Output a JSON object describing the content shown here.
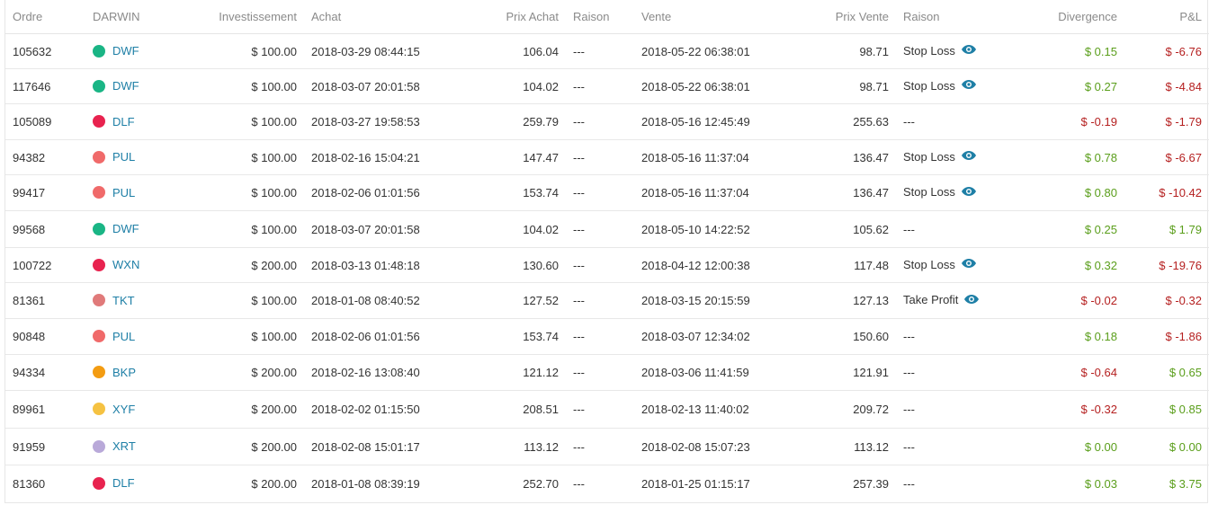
{
  "colors": {
    "link": "#1e7fa6",
    "positive": "#5a9e1b",
    "negative": "#b52020",
    "eye_icon": "#1e7fa6"
  },
  "headers": {
    "ordre": "Ordre",
    "darwin": "DARWIN",
    "investissement": "Investissement",
    "achat": "Achat",
    "prix_achat": "Prix Achat",
    "raison_achat": "Raison",
    "vente": "Vente",
    "prix_vente": "Prix Vente",
    "raison_vente": "Raison",
    "divergence": "Divergence",
    "pl": "P&L"
  },
  "rows": [
    {
      "ordre": "105632",
      "darwin": "DWF",
      "color": "#1ab585",
      "investissement": "$ 100.00",
      "achat": "2018-03-29 08:44:15",
      "prix_achat": "106.04",
      "raison_achat": "---",
      "vente": "2018-05-22 06:38:01",
      "prix_vente": "98.71",
      "raison_vente": "Stop Loss",
      "eye": true,
      "divergence": "$ 0.15",
      "divergence_sign": "pos",
      "pl": "$ -6.76",
      "pl_sign": "neg"
    },
    {
      "ordre": "117646",
      "darwin": "DWF",
      "color": "#1ab585",
      "investissement": "$ 100.00",
      "achat": "2018-03-07 20:01:58",
      "prix_achat": "104.02",
      "raison_achat": "---",
      "vente": "2018-05-22 06:38:01",
      "prix_vente": "98.71",
      "raison_vente": "Stop Loss",
      "eye": true,
      "divergence": "$ 0.27",
      "divergence_sign": "pos",
      "pl": "$ -4.84",
      "pl_sign": "neg"
    },
    {
      "ordre": "105089",
      "darwin": "DLF",
      "color": "#e8234f",
      "investissement": "$ 100.00",
      "achat": "2018-03-27 19:58:53",
      "prix_achat": "259.79",
      "raison_achat": "---",
      "vente": "2018-05-16 12:45:49",
      "prix_vente": "255.63",
      "raison_vente": "---",
      "eye": false,
      "divergence": "$ -0.19",
      "divergence_sign": "neg",
      "pl": "$ -1.79",
      "pl_sign": "neg"
    },
    {
      "ordre": "94382",
      "darwin": "PUL",
      "color": "#f06a6a",
      "investissement": "$ 100.00",
      "achat": "2018-02-16 15:04:21",
      "prix_achat": "147.47",
      "raison_achat": "---",
      "vente": "2018-05-16 11:37:04",
      "prix_vente": "136.47",
      "raison_vente": "Stop Loss",
      "eye": true,
      "divergence": "$ 0.78",
      "divergence_sign": "pos",
      "pl": "$ -6.67",
      "pl_sign": "neg"
    },
    {
      "ordre": "99417",
      "darwin": "PUL",
      "color": "#f06a6a",
      "investissement": "$ 100.00",
      "achat": "2018-02-06 01:01:56",
      "prix_achat": "153.74",
      "raison_achat": "---",
      "vente": "2018-05-16 11:37:04",
      "prix_vente": "136.47",
      "raison_vente": "Stop Loss",
      "eye": true,
      "divergence": "$ 0.80",
      "divergence_sign": "pos",
      "pl": "$ -10.42",
      "pl_sign": "neg"
    },
    {
      "ordre": "99568",
      "darwin": "DWF",
      "color": "#1ab585",
      "investissement": "$ 100.00",
      "achat": "2018-03-07 20:01:58",
      "prix_achat": "104.02",
      "raison_achat": "---",
      "vente": "2018-05-10 14:22:52",
      "prix_vente": "105.62",
      "raison_vente": "---",
      "eye": false,
      "divergence": "$ 0.25",
      "divergence_sign": "pos",
      "pl": "$ 1.79",
      "pl_sign": "pos"
    },
    {
      "ordre": "100722",
      "darwin": "WXN",
      "color": "#e8234f",
      "investissement": "$ 200.00",
      "achat": "2018-03-13 01:48:18",
      "prix_achat": "130.60",
      "raison_achat": "---",
      "vente": "2018-04-12 12:00:38",
      "prix_vente": "117.48",
      "raison_vente": "Stop Loss",
      "eye": true,
      "divergence": "$ 0.32",
      "divergence_sign": "pos",
      "pl": "$ -19.76",
      "pl_sign": "neg"
    },
    {
      "ordre": "81361",
      "darwin": "TKT",
      "color": "#e07a7a",
      "investissement": "$ 100.00",
      "achat": "2018-01-08 08:40:52",
      "prix_achat": "127.52",
      "raison_achat": "---",
      "vente": "2018-03-15 20:15:59",
      "prix_vente": "127.13",
      "raison_vente": "Take Profit",
      "eye": true,
      "divergence": "$ -0.02",
      "divergence_sign": "neg",
      "pl": "$ -0.32",
      "pl_sign": "neg"
    },
    {
      "ordre": "90848",
      "darwin": "PUL",
      "color": "#f06a6a",
      "investissement": "$ 100.00",
      "achat": "2018-02-06 01:01:56",
      "prix_achat": "153.74",
      "raison_achat": "---",
      "vente": "2018-03-07 12:34:02",
      "prix_vente": "150.60",
      "raison_vente": "---",
      "eye": false,
      "divergence": "$ 0.18",
      "divergence_sign": "pos",
      "pl": "$ -1.86",
      "pl_sign": "neg"
    },
    {
      "ordre": "94334",
      "darwin": "BKP",
      "color": "#f39c12",
      "investissement": "$ 200.00",
      "achat": "2018-02-16 13:08:40",
      "prix_achat": "121.12",
      "raison_achat": "---",
      "vente": "2018-03-06 11:41:59",
      "prix_vente": "121.91",
      "raison_vente": "---",
      "eye": false,
      "divergence": "$ -0.64",
      "divergence_sign": "neg",
      "pl": "$ 0.65",
      "pl_sign": "pos"
    },
    {
      "ordre": "89961",
      "darwin": "XYF",
      "color": "#f5c242",
      "investissement": "$ 200.00",
      "achat": "2018-02-02 01:15:50",
      "prix_achat": "208.51",
      "raison_achat": "---",
      "vente": "2018-02-13 11:40:02",
      "prix_vente": "209.72",
      "raison_vente": "---",
      "eye": false,
      "divergence": "$ -0.32",
      "divergence_sign": "neg",
      "pl": "$ 0.85",
      "pl_sign": "pos"
    },
    {
      "ordre": "91959",
      "darwin": "XRT",
      "color": "#b9a9d9",
      "investissement": "$ 200.00",
      "achat": "2018-02-08 15:01:17",
      "prix_achat": "113.12",
      "raison_achat": "---",
      "vente": "2018-02-08 15:07:23",
      "prix_vente": "113.12",
      "raison_vente": "---",
      "eye": false,
      "divergence": "$ 0.00",
      "divergence_sign": "pos",
      "pl": "$ 0.00",
      "pl_sign": "pos"
    },
    {
      "ordre": "81360",
      "darwin": "DLF",
      "color": "#e8234f",
      "investissement": "$ 200.00",
      "achat": "2018-01-08 08:39:19",
      "prix_achat": "252.70",
      "raison_achat": "---",
      "vente": "2018-01-25 01:15:17",
      "prix_vente": "257.39",
      "raison_vente": "---",
      "eye": false,
      "divergence": "$ 0.03",
      "divergence_sign": "pos",
      "pl": "$ 3.75",
      "pl_sign": "pos"
    }
  ]
}
